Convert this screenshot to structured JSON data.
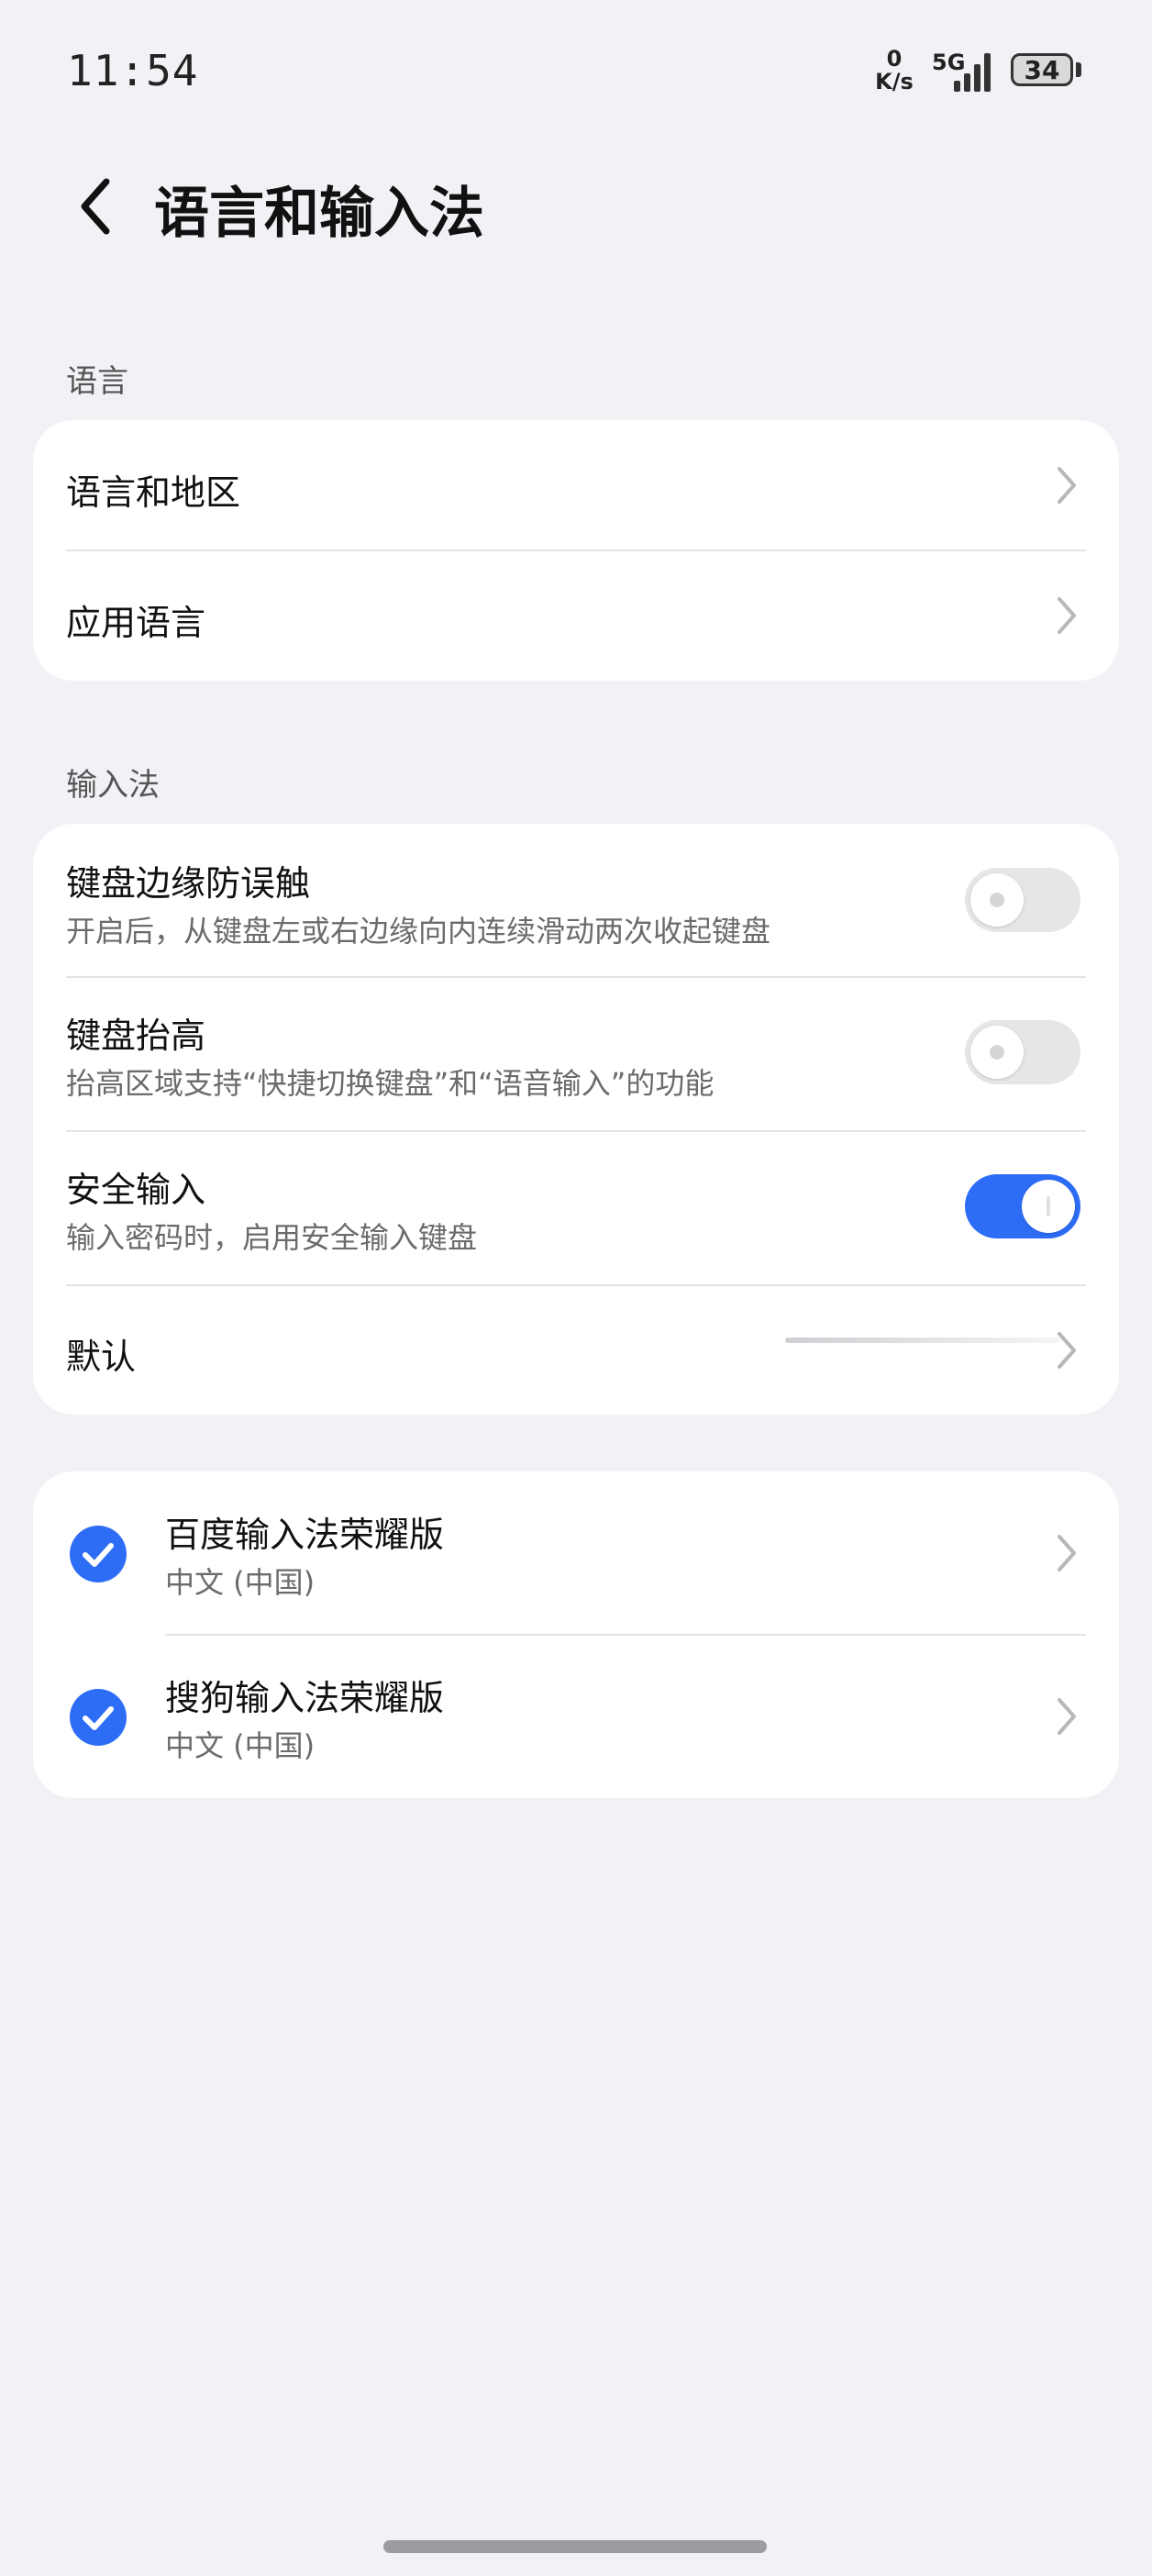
{
  "status_bar": {
    "time": "11:54",
    "net_speed_value": "0",
    "net_speed_unit": "K/s",
    "network_type": "5G",
    "battery": "34"
  },
  "header": {
    "title": "语言和输入法"
  },
  "sections": {
    "language": {
      "title": "语言",
      "items": [
        {
          "label": "语言和地区"
        },
        {
          "label": "应用语言"
        }
      ]
    },
    "input": {
      "title": "输入法",
      "items": [
        {
          "label": "键盘边缘防误触",
          "subtitle": "开启后，从键盘左或右边缘向内连续滑动两次收起键盘",
          "enabled": false
        },
        {
          "label": "键盘抬高",
          "subtitle": "抬高区域支持“快捷切换键盘”和“语音输入”的功能",
          "enabled": false
        },
        {
          "label": "安全输入",
          "subtitle": "输入密码时，启用安全输入键盘",
          "enabled": true
        },
        {
          "label": "默认"
        }
      ]
    },
    "keyboards": {
      "items": [
        {
          "label": "百度输入法荣耀版",
          "subtitle": "中文 (中国)",
          "checked": true
        },
        {
          "label": "搜狗输入法荣耀版",
          "subtitle": "中文 (中国)",
          "checked": true
        }
      ]
    }
  },
  "colors": {
    "accent": "#2d6df6",
    "background": "#f1f2f6",
    "card": "#ffffff"
  }
}
